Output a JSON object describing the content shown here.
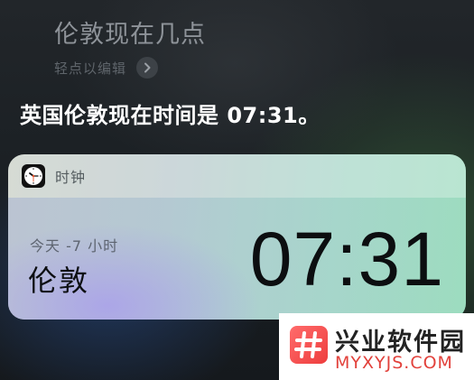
{
  "siri": {
    "query": "伦敦现在几点",
    "edit_hint": "轻点以编辑",
    "response": "英国伦敦现在时间是 07:31。"
  },
  "clock_card": {
    "app_name": "时钟",
    "app_icon": "clock-icon",
    "day_offset": "今天 -7 小时",
    "city": "伦敦",
    "time": "07:31"
  },
  "watermark": {
    "title": "兴业软件园",
    "subtitle": "MYXYJS.COM"
  }
}
